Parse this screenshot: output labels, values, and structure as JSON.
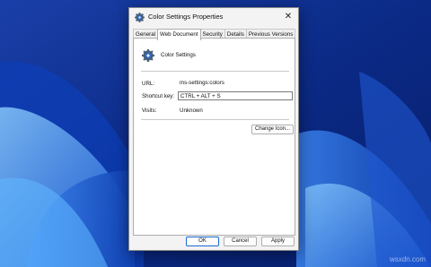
{
  "dialog": {
    "title": "Color Settings Properties",
    "close_label": "✕",
    "tabs": [
      {
        "label": "General",
        "active": false
      },
      {
        "label": "Web Document",
        "active": true
      },
      {
        "label": "Security",
        "active": false
      },
      {
        "label": "Details",
        "active": false
      },
      {
        "label": "Previous Versions",
        "active": false
      }
    ],
    "name": "Color Settings",
    "url_label": "URL:",
    "url_value": "ms-settings:colors",
    "shortcut_label": "Shortcut key:",
    "shortcut_value": "CTRL + ALT + S",
    "visits_label": "Visits:",
    "visits_value": "Unknown",
    "change_icon_label": "Change Icon...",
    "ok_label": "OK",
    "cancel_label": "Cancel",
    "apply_label": "Apply",
    "icon": "gear-icon"
  },
  "watermark": "wsxdn.com",
  "colors": {
    "accent": "#1a6ad3",
    "wallpaper_dark": "#0a2a8a",
    "wallpaper_light": "#4fa6ff"
  }
}
